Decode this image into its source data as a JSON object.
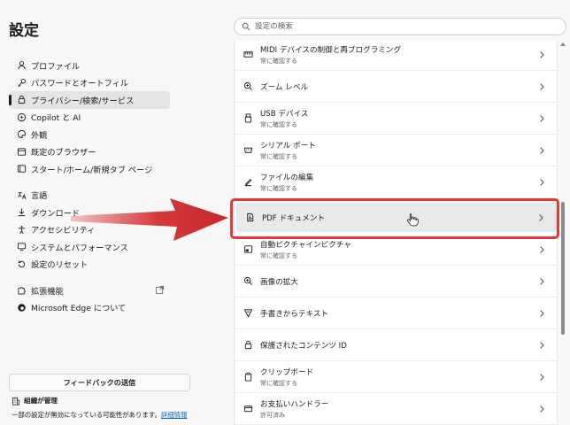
{
  "sidebar": {
    "title": "設定",
    "items": [
      {
        "label": "プロファイル",
        "icon": "profile-icon"
      },
      {
        "label": "パスワードとオートフィル",
        "icon": "key-icon"
      },
      {
        "label": "プライバシー/検索/サービス",
        "icon": "lock-icon",
        "active": true
      },
      {
        "label": "Copilot と AI",
        "icon": "copilot-icon"
      },
      {
        "label": "外観",
        "icon": "palette-icon"
      },
      {
        "label": "既定のブラウザー",
        "icon": "browser-icon"
      },
      {
        "label": "スタート/ホーム/新規タブ ページ",
        "icon": "home-icon"
      },
      {
        "label": "言語",
        "icon": "language-icon"
      },
      {
        "label": "ダウンロード",
        "icon": "download-icon"
      },
      {
        "label": "アクセシビリティ",
        "icon": "accessibility-icon"
      },
      {
        "label": "システムとパフォーマンス",
        "icon": "system-icon"
      },
      {
        "label": "設定のリセット",
        "icon": "reset-icon"
      },
      {
        "label": "拡張機能",
        "icon": "extensions-icon"
      },
      {
        "label": "Microsoft Edge について",
        "icon": "edge-icon"
      }
    ],
    "feedback_button": "フィードバックの送信",
    "managed_label": "組織が管理",
    "managed_note": "一部の設定が無効になっている可能性があります。",
    "managed_link": "詳細情報"
  },
  "search": {
    "placeholder": "設定の検索"
  },
  "rows": [
    {
      "label": "MIDI デバイスの制御と再プログラミング",
      "sub": "常に確認する",
      "icon": "midi-icon"
    },
    {
      "label": "ズーム レベル",
      "sub": "",
      "icon": "zoom-icon"
    },
    {
      "label": "USB デバイス",
      "sub": "常に確認する",
      "icon": "usb-icon"
    },
    {
      "label": "シリアル ポート",
      "sub": "常に確認する",
      "icon": "serial-port-icon"
    },
    {
      "label": "ファイルの編集",
      "sub": "常に確認する",
      "icon": "file-edit-icon"
    },
    {
      "label": "PDF ドキュメント",
      "sub": "",
      "icon": "pdf-icon",
      "highlighted": true
    },
    {
      "label": "自動ピクチャインピクチャ",
      "sub": "常に確認する",
      "icon": "pip-icon"
    },
    {
      "label": "画像の拡大",
      "sub": "",
      "icon": "image-zoom-icon"
    },
    {
      "label": "手書きからテキスト",
      "sub": "",
      "icon": "handwriting-icon"
    },
    {
      "label": "保護されたコンテンツ ID",
      "sub": "",
      "icon": "protected-content-icon"
    },
    {
      "label": "クリップボード",
      "sub": "常に確認する",
      "icon": "clipboard-icon"
    },
    {
      "label": "お支払いハンドラー",
      "sub": "許可済み",
      "icon": "payment-icon"
    }
  ],
  "colors": {
    "highlight_border": "#e53935",
    "arrow": "#d32f2f",
    "link": "#0f6cbd"
  }
}
